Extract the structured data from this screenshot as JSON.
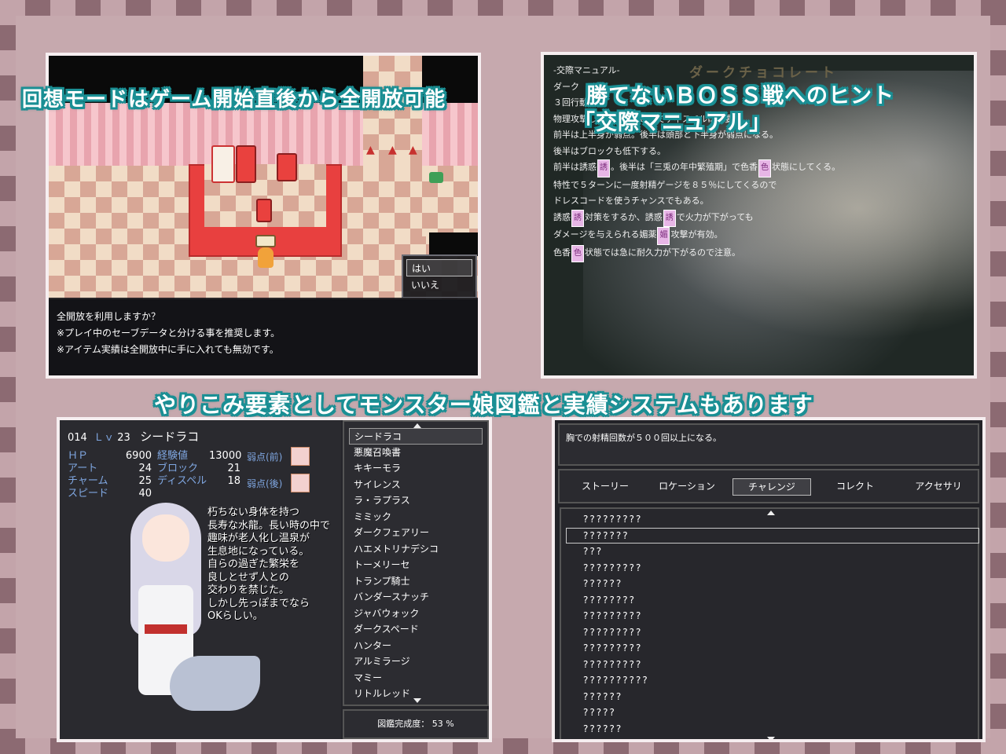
{
  "titles": {
    "top_left": "回想モードはゲーム開始直後から全開放可能",
    "top_right_1": "勝てないＢＯＳＳ戦へのヒント",
    "top_right_2": "「交際マニュアル」",
    "middle": "やりこみ要素としてモンスター娘図鑑と実績システムもあります"
  },
  "map_panel": {
    "messages": [
      "全開放を利用しますか？",
      "※プレイ中のセーブデータと分ける事を推奨します。",
      "※アイテム実績は全開放中に手に入れても無効です。"
    ],
    "choices": [
      "はい",
      "いいえ"
    ]
  },
  "manual_panel": {
    "heading": "ダークチョコレート",
    "lines": [
      "-交際マニュアル-",
      "ダーク",
      "",
      "３回行動。",
      "物理攻撃しかしてこないのでディスペルは不要。",
      "",
      "前半は上半身が弱点。後半は頭部と下半身が弱点になる。",
      "後半はブロックも低下する。",
      "",
      "前半は誘惑",
      "特性で５ターンに一度射精ゲージを８５％にしてくるので",
      "ドレスコードを使うチャンスでもある。",
      "",
      "",
      "誘惑",
      "ダメージを与えられる媚薬",
      "色香"
    ],
    "line9_rest": "。後半は「三兎の年中繁殖期」で色香",
    "line9_end": "状態にしてくる。",
    "line14_mid": "対策をするか、誘惑",
    "line14_end": "で火力が下がっても",
    "line15_end": "攻撃が有効。",
    "line16_end": "状態では急に耐久力が下がるので注意。",
    "badges": {
      "yuu": "誘",
      "iro": "色",
      "bi": "媚"
    }
  },
  "bestiary_panel": {
    "number": "014",
    "level_label": "Ｌｖ",
    "level": "23",
    "name": "シードラコ",
    "stats": [
      {
        "label": "ＨＰ",
        "value": "6900"
      },
      {
        "label": "アート",
        "value": "24"
      },
      {
        "label": "チャーム",
        "value": "25"
      },
      {
        "label": "スピード",
        "value": "40"
      }
    ],
    "stats2": [
      {
        "label": "経験値",
        "value": "13000"
      },
      {
        "label": "ブロック",
        "value": "21"
      },
      {
        "label": "ディスペル",
        "value": "18"
      }
    ],
    "weak_front": "弱点(前)",
    "weak_back": "弱点(後)",
    "description": [
      "朽ちない身体を持つ",
      "長寿な水龍。長い時の中で",
      "趣味が老人化し温泉が",
      "生息地になっている。",
      "自らの過ぎた繁栄を",
      "良しとせず人との",
      "交わりを禁じた。",
      "しかし先っぽまでなら",
      "OKらしい。"
    ],
    "monsters": [
      "シードラコ",
      "悪魔召喚書",
      "キキーモラ",
      "サイレンス",
      "ラ・ラプラス",
      "ミミック",
      "ダークフェアリー",
      "ハエメトリナデシコ",
      "トーメリーセ",
      "トランプ騎士",
      "バンダースナッチ",
      "ジャバウォック",
      "ダークスペード",
      "ハンター",
      "アルミラージ",
      "マミー",
      "リトルレッド"
    ],
    "completion": "図鑑完成度： 53 %"
  },
  "achievement_panel": {
    "description": "胸での射精回数が５００回以上になる。",
    "tabs": [
      "ストーリー",
      "ロケーション",
      "チャレンジ",
      "コレクト",
      "アクセサリ"
    ],
    "selected_tab": 2,
    "items": [
      "?????????",
      "???????",
      "???",
      "?????????",
      "??????",
      "????????",
      "?????????",
      "?????????",
      "?????????",
      "?????????",
      "??????????",
      "??????",
      "?????",
      "??????"
    ],
    "selected_item": 1
  }
}
